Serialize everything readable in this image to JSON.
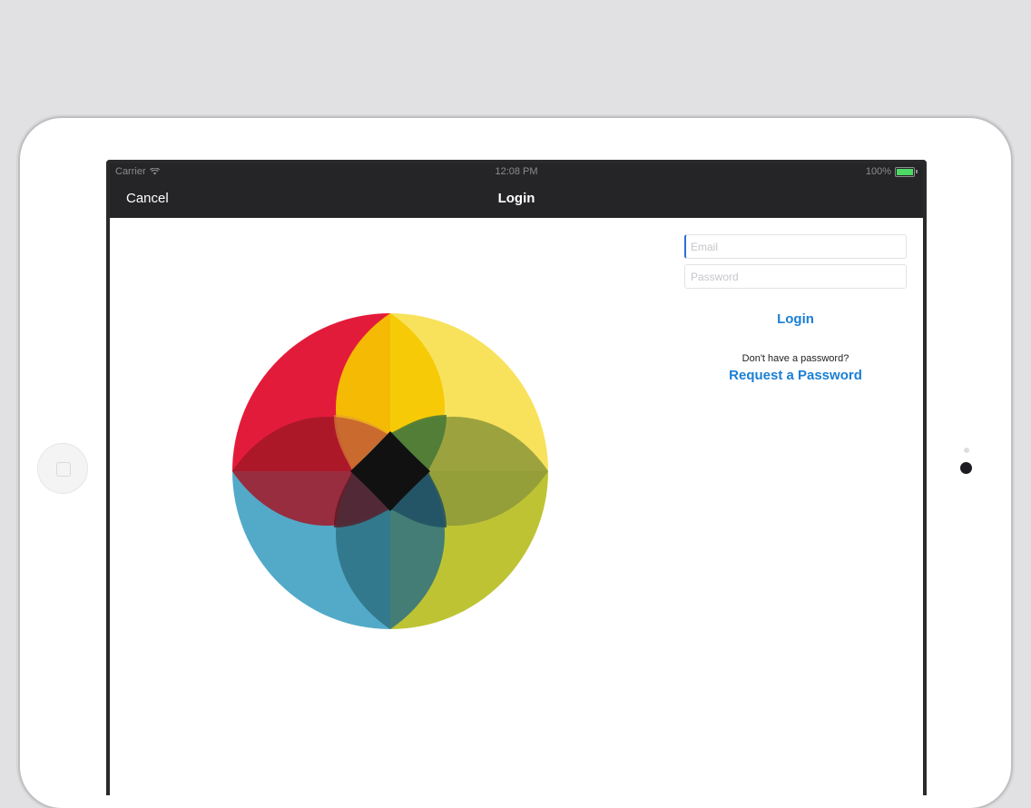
{
  "status_bar": {
    "carrier": "Carrier",
    "time": "12:08 PM",
    "battery": "100%"
  },
  "nav": {
    "cancel_label": "Cancel",
    "title": "Login"
  },
  "form": {
    "email_placeholder": "Email",
    "email_value": "",
    "password_placeholder": "Password",
    "password_value": "",
    "login_label": "Login",
    "hint_text": "Don't have a password?",
    "request_label": "Request a Password"
  },
  "logo": {
    "name": "four-petal-color-wheel",
    "colors": {
      "red": "#e31b3b",
      "yellow": "#f6d200",
      "blue": "#4aa6c8",
      "olive": "#b6c21f",
      "center": "#111111"
    }
  }
}
